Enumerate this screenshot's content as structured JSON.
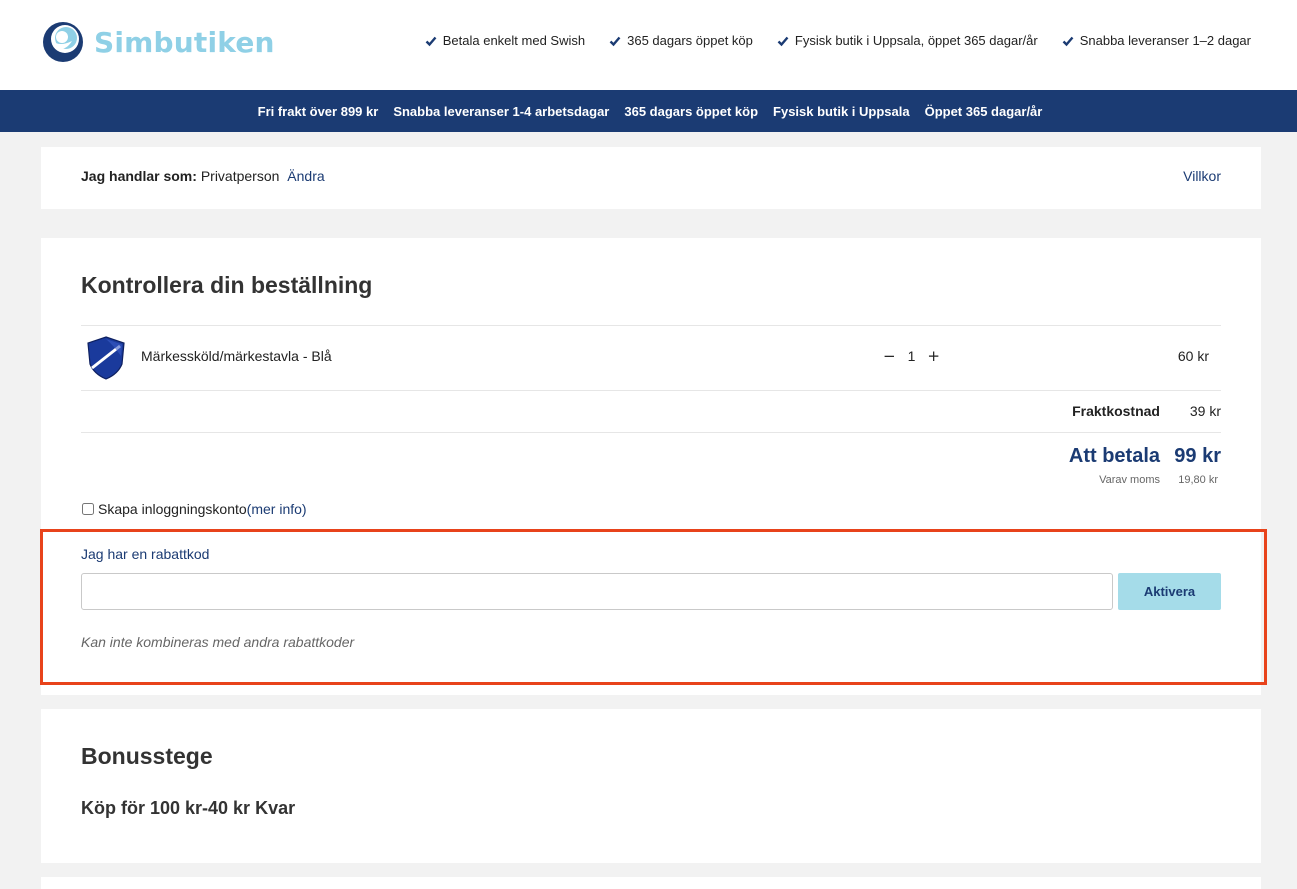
{
  "header": {
    "logo_text": "Simbutiken",
    "usps": [
      "Betala enkelt med Swish",
      "365 dagars öppet köp",
      "Fysisk butik i Uppsala, öppet 365 dagar/år",
      "Snabba leveranser 1–2 dagar"
    ]
  },
  "navbar": {
    "items": [
      "Fri frakt över 899 kr",
      "Snabba leveranser 1-4 arbetsdagar",
      "365 dagars öppet köp",
      "Fysisk butik i Uppsala",
      "Öppet 365 dagar/år"
    ]
  },
  "shopping_as": {
    "label": "Jag handlar som:",
    "value": "Privatperson",
    "change_link": "Ändra",
    "terms_link": "Villkor"
  },
  "order": {
    "title": "Kontrollera din beställning",
    "product": {
      "name": "Märkessköld/märkestavla - Blå",
      "quantity": "1",
      "decrease": "−",
      "increase": "+",
      "price": "60 kr"
    },
    "shipping_label": "Fraktkostnad",
    "shipping_value": "39 kr",
    "total_label": "Att betala",
    "total_value": "99 kr",
    "vat_label": "Varav moms",
    "vat_value": "19,80 kr",
    "create_account_label": "Skapa inloggningskonto",
    "more_info": "(mer info)"
  },
  "promo": {
    "toggle": "Jag har en rabattkod",
    "input_value": "",
    "button": "Aktivera",
    "note": "Kan inte kombineras med andra rabattkoder"
  },
  "bonus": {
    "title": "Bonusstege",
    "step": "Köp för 100 kr-40 kr Kvar"
  },
  "colors": {
    "brand_navy": "#1b3b73",
    "logo_light_blue": "#8fd0e6",
    "button_bg": "#a5dce9",
    "highlight_border": "#e8431b"
  }
}
